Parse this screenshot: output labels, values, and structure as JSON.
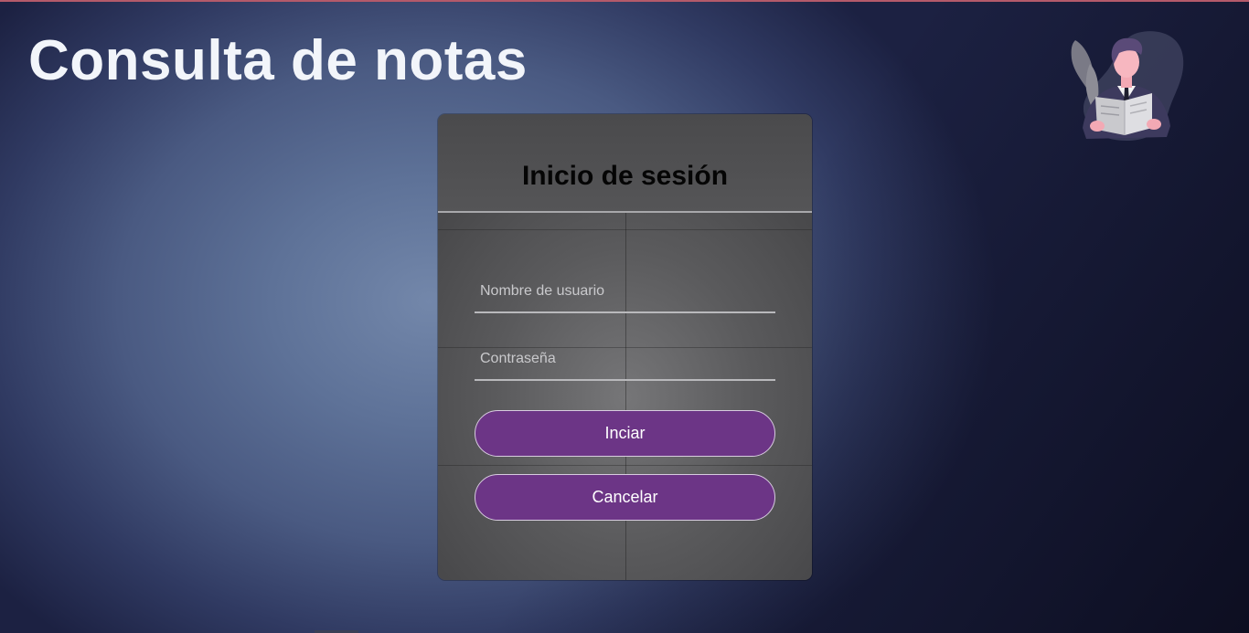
{
  "page": {
    "title": "Consulta de notas"
  },
  "login": {
    "title": "Inicio de sesión",
    "username_placeholder": "Nombre de usuario",
    "username_value": "",
    "password_placeholder": "Contraseña",
    "password_value": "",
    "submit_label": "Inciar",
    "cancel_label": "Cancelar"
  },
  "illustration": {
    "icon": "person-reading-newspaper-icon"
  },
  "colors": {
    "accent_button": "#6c3586",
    "title_text": "#f2f5fa",
    "card_bg": "#5a5a5c"
  }
}
